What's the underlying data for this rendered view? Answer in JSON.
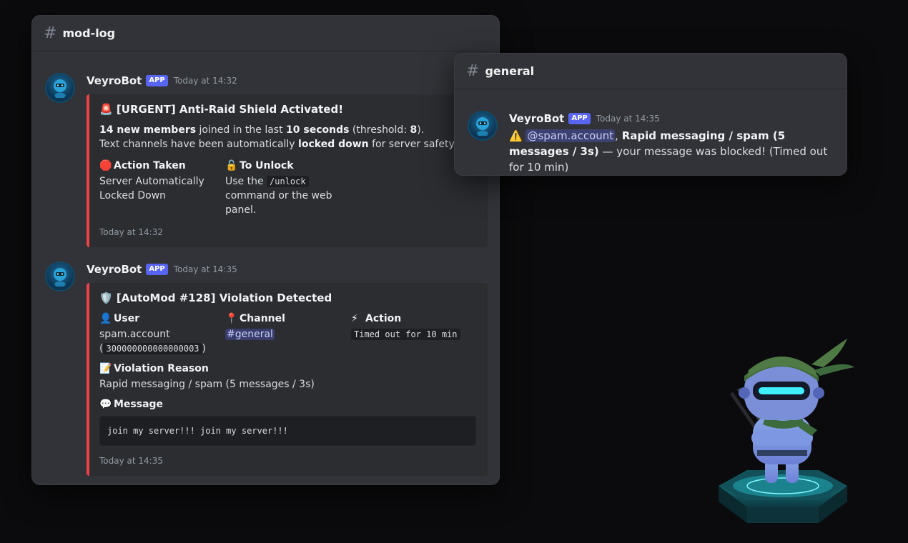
{
  "modlog": {
    "channel": "mod-log",
    "msg1": {
      "author": "VeyroBot",
      "badge": "APP",
      "time": "Today at 14:32",
      "title_emoji": "🚨",
      "title": "[URGENT] Anti-Raid Shield Activated!",
      "line1_b1": "14 new members",
      "line1_t1": " joined in the last ",
      "line1_b2": "10 seconds",
      "line1_t2": " (threshold: ",
      "line1_b3": "8",
      "line1_t3": ").",
      "line2_t1": "Text channels have been automatically ",
      "line2_b1": "locked down",
      "line2_t2": " for server safety!",
      "field1_emoji": "🛑",
      "field1_name": "Action Taken",
      "field1_value": "Server Automatically Locked Down",
      "field2_emoji": "🔓",
      "field2_name": "To Unlock",
      "field2_t1": "Use the ",
      "field2_code": "/unlock",
      "field2_t2": " command or the web panel.",
      "footer": "Today at 14:32"
    },
    "msg2": {
      "author": "VeyroBot",
      "badge": "APP",
      "time": "Today at 14:35",
      "title_emoji": "🛡️",
      "title": "[AutoMod #128] Violation Detected",
      "user_emoji": "👤",
      "user_name": "User",
      "user_value": "spam.account",
      "user_id": "300000000000000003",
      "channel_emoji": "📍",
      "channel_name": "Channel",
      "channel_value": "#general",
      "action_emoji": "⚡",
      "action_name": "Action",
      "action_value": "Timed out for 10 min",
      "reason_emoji": "📝",
      "reason_name": "Violation Reason",
      "reason_value": "Rapid messaging / spam (5 messages / 3s)",
      "message_emoji": "💬",
      "message_name": "Message",
      "message_value": "join my server!!! join my server!!!",
      "footer": "Today at 14:35"
    }
  },
  "general": {
    "channel": "general",
    "msg": {
      "author": "VeyroBot",
      "badge": "APP",
      "time": "Today at 14:35",
      "warn_emoji": "⚠️",
      "mention": "@spam.account",
      "bold_text": "Rapid messaging / spam (5 messages / 3s)",
      "rest_text": " — your message was blocked! (Timed out for 10 min)"
    }
  },
  "colors": {
    "accent": "#5865f2",
    "embed_border": "#ed4245",
    "background": "#0b0b0d",
    "panel": "#313338"
  }
}
